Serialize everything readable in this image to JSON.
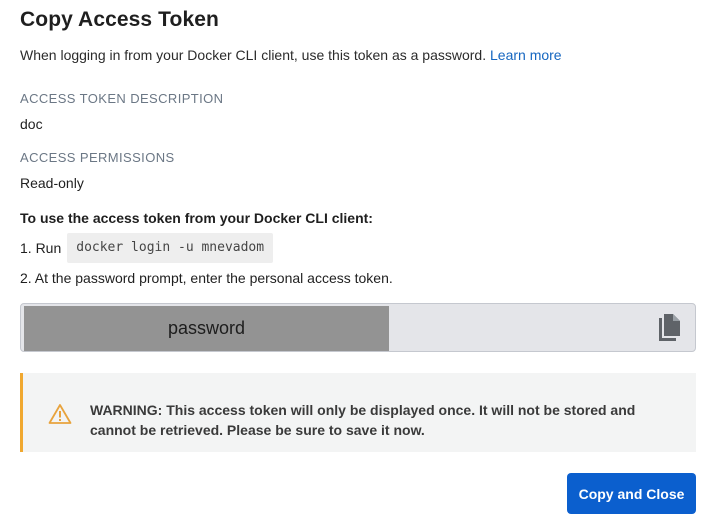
{
  "dialog": {
    "title": "Copy Access Token",
    "subtitle": "When logging in from your Docker CLI client, use this token as a password.",
    "learn_more": "Learn more"
  },
  "description": {
    "label": "ACCESS TOKEN DESCRIPTION",
    "value": "doc"
  },
  "permissions": {
    "label": "ACCESS PERMISSIONS",
    "value": "Read-only"
  },
  "instructions": {
    "heading": "To use the access token from your Docker CLI client:",
    "step1_prefix": "1. Run",
    "step1_command": "docker login -u mnevadom",
    "step2": "2. At the password prompt, enter the personal access token."
  },
  "token": {
    "masked_text": "password",
    "copy_icon": "copy-icon"
  },
  "warning": {
    "icon": "warning-icon",
    "text": "WARNING: This access token will only be displayed once. It will not be stored and cannot be retrieved. Please be sure to save it now.",
    "accent_color": "#f0a830"
  },
  "actions": {
    "copy_and_close": "Copy and Close"
  },
  "colors": {
    "primary": "#0b5fce",
    "link": "#1566c0"
  }
}
